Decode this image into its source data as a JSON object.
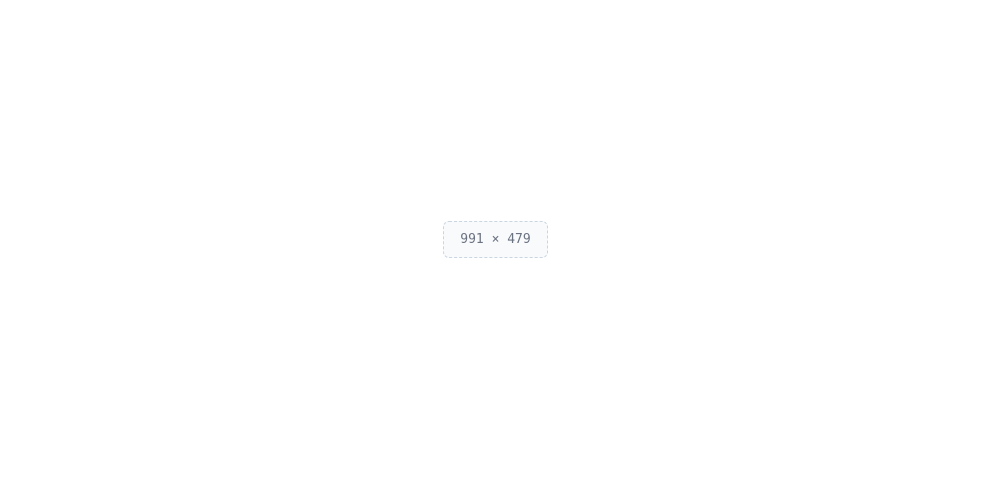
{
  "placeholder": {
    "message": "991 × 479"
  }
}
